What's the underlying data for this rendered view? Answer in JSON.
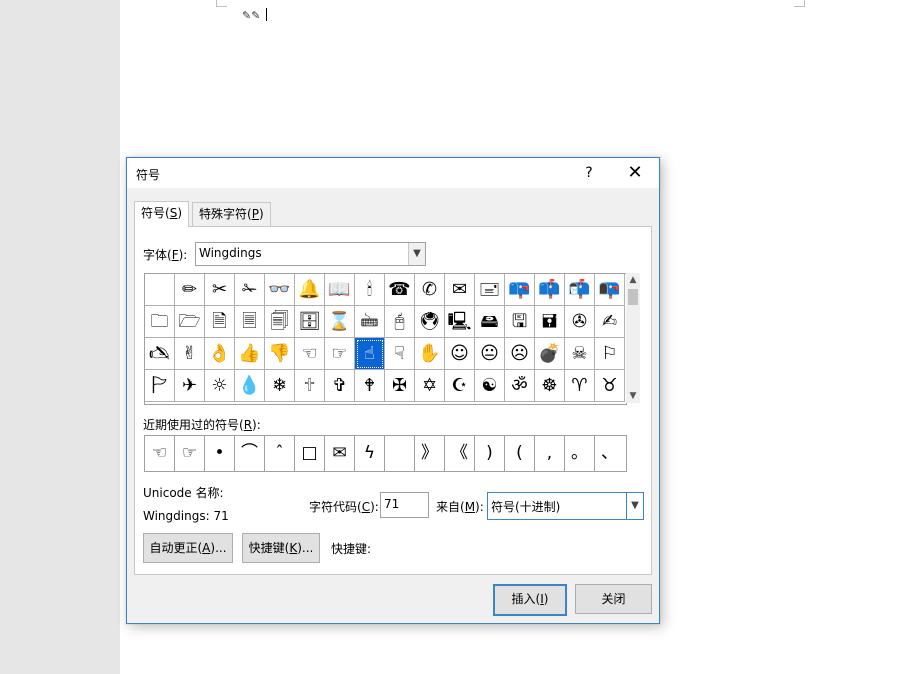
{
  "document": {
    "line_glyphs": "✎✎"
  },
  "dialog": {
    "title": "符号",
    "help_label": "?",
    "close_label": "✕",
    "tabs": [
      {
        "label": "符号(",
        "key": "S",
        "suffix": ")"
      },
      {
        "label": "特殊字符(",
        "key": "P",
        "suffix": ")"
      }
    ],
    "font_label": {
      "text": "字体(",
      "key": "F",
      "suffix": "):"
    },
    "font_value": "Wingdings",
    "symbol_rows": [
      [
        "",
        "✏",
        "✂",
        "✁",
        "👓",
        "🔔",
        "📖",
        "🕯",
        "☎",
        "✆",
        "✉",
        "🖃",
        "📪",
        "📫",
        "📬",
        "📭"
      ],
      [
        "🗀",
        "🗁",
        "🗎",
        "🗏",
        "🗐",
        "🗄",
        "⌛",
        "🖮",
        "🖰",
        "🖲",
        "🖳",
        "🖴",
        "🖫",
        "🖬",
        "✇",
        "✍"
      ],
      [
        "🖎",
        "✌",
        "👌",
        "👍",
        "👎",
        "☜",
        "☞",
        "☝",
        "☟",
        "✋",
        "☺",
        "😐",
        "☹",
        "💣",
        "☠",
        "⚐"
      ],
      [
        "🏱",
        "✈",
        "☼",
        "💧",
        "❄",
        "🕆",
        "✞",
        "🕈",
        "✠",
        "✡",
        "☪",
        "☯",
        "ॐ",
        "☸",
        "♈",
        "♉"
      ]
    ],
    "selected_cell": {
      "row": 2,
      "col": 7
    },
    "recent_label": {
      "text": "近期使用过的符号(",
      "key": "R",
      "suffix": "):"
    },
    "recent_symbols": [
      "☜",
      "☞",
      "•",
      "⌒",
      "ˆ",
      "□",
      "✉",
      "ϟ",
      "",
      "》",
      "《",
      ")",
      "(",
      ",",
      "。",
      "、"
    ],
    "unicode_name_label": "Unicode 名称:",
    "char_name": "Wingdings: 71",
    "char_code_label": {
      "text": "字符代码(",
      "key": "C",
      "suffix": "):"
    },
    "char_code_value": "71",
    "from_label": {
      "text": "来自(",
      "key": "M",
      "suffix": "):"
    },
    "from_value": "符号(十进制)",
    "autocorrect_button": {
      "text": "自动更正(",
      "key": "A",
      "suffix": ")..."
    },
    "shortcut_button": {
      "text": "快捷键(",
      "key": "K",
      "suffix": ")..."
    },
    "shortcut_label": "快捷键:",
    "insert_button": {
      "text": "插入(",
      "key": "I",
      "suffix": ")"
    },
    "close_button": "关闭"
  }
}
